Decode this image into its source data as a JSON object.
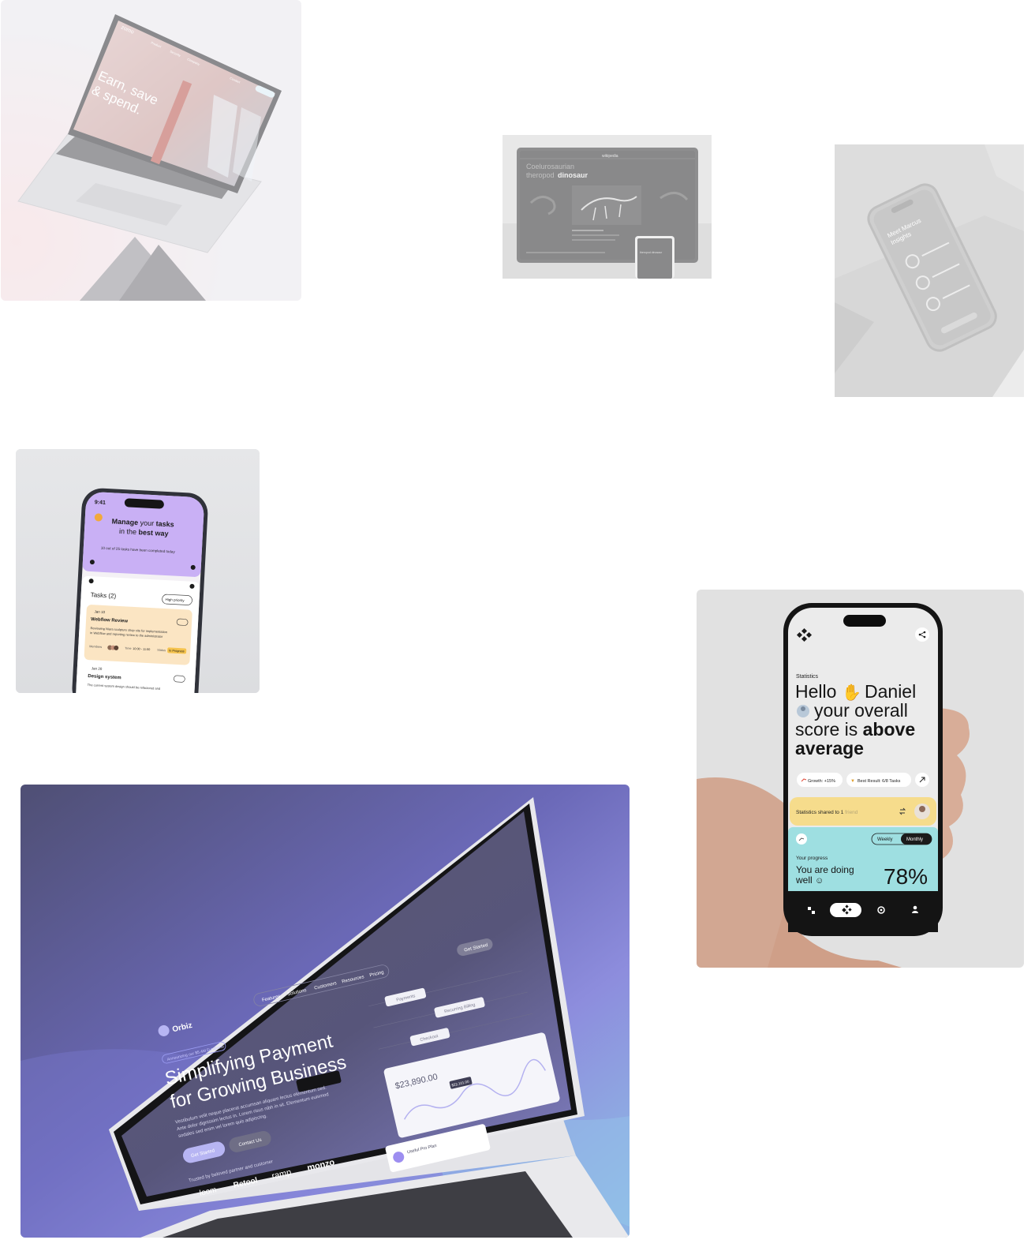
{
  "card1": {
    "brand": "zomo",
    "nav": [
      "Product",
      "Security",
      "Company",
      "Contact"
    ],
    "hero_line1": "Earn, save",
    "hero_line2": "& spend."
  },
  "card2": {
    "brand": "wikipedia",
    "title_line1": "Coelurosaurian",
    "title_word1": "theropod",
    "title_word2": "dinosaur",
    "mini_title": "theropod dinosaur"
  },
  "card3": {
    "title_line1": "Meet Marcus",
    "title_line2": "Insights"
  },
  "card4": {
    "time": "9:41",
    "headline_a": "Manage",
    "headline_b": "your",
    "headline_c": "tasks",
    "headline_d": "in the",
    "headline_e": "best way",
    "completed": "10 out of 25 tasks have been completed today",
    "tasks_title": "Tasks (2)",
    "filter": "High priority",
    "task1": {
      "date": "Jan 10",
      "title": "Webflow Review",
      "desc_line1": "Reviewing Niara sculpture shop site for implementation",
      "desc_line2": "in Webflow and reporting review to the administrator",
      "members_label": "Members",
      "time_label": "Time",
      "time": "10:00 - 11:00",
      "status_label": "Status",
      "status": "In Progress"
    },
    "task2": {
      "date": "Jan 20",
      "title": "Design system",
      "desc": "The current system design should be refactored and"
    }
  },
  "card5": {
    "section": "Statistics",
    "hello": "Hello",
    "name": "Daniel",
    "line2": "your overall",
    "line3a": "score is",
    "line3b": "above",
    "line4": "average",
    "growth": "Growth: +15%",
    "best_result": "Best Result: 6/8 Tasks",
    "shared": "Statistics shared to 1",
    "shared_friend": "friend",
    "tab_weekly": "Weekly",
    "tab_monthly": "Monthly",
    "progress_label": "Your progress",
    "progress_line1": "You are doing",
    "progress_line2": "well",
    "percent": "78%",
    "progress_value": 0.78
  },
  "card6": {
    "logo": "Orbiz",
    "nav": [
      "Features",
      "Solutions",
      "Customers",
      "Resources",
      "Pricing"
    ],
    "cta": "Get Started",
    "badge": "Announcing our $5.4M Fundraise",
    "headline1": "Simplifying Payment",
    "headline2": "for Growing Business",
    "body1": "Vestibulum velit neque placerat accumsan aliquam lectus elementum sed.",
    "body2": "Ante dolor dignissim lectus in. Lorem risus nibh in sit. Elementum euismod",
    "body3": "sodales sed enim vel lorem quis adipiscing.",
    "btn_primary": "Get Started",
    "btn_secondary": "Contact Us",
    "trusted": "Trusted by beloved partner and customer",
    "logos": [
      "loom",
      "Retool",
      "ramp",
      "monzo"
    ],
    "chip_payments": "Payments",
    "chip_recurring": "Recurring Billing",
    "chip_checkout": "Checkout",
    "balance": "$23,890.00",
    "tooltip": "$22,101.00",
    "pro_plan": "Useful Pro Plan"
  }
}
